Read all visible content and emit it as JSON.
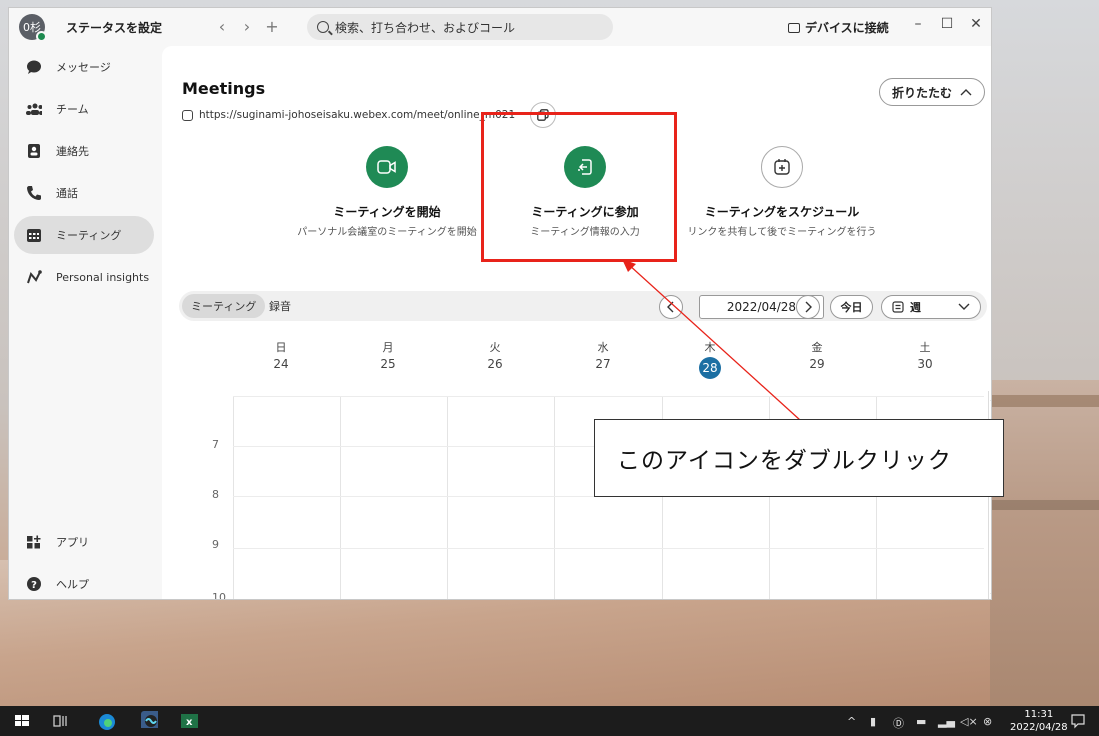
{
  "titlebar": {
    "avatar_initials": "0杉",
    "status_label": "ステータスを設定",
    "back": "‹",
    "forward": "›",
    "add": "+",
    "search_placeholder": "検索、打ち合わせ、およびコール",
    "device_connect": "デバイスに接続",
    "minimize": "–",
    "maximize": "☐",
    "close": "✕"
  },
  "sidebar": {
    "items": [
      {
        "label": "メッセージ",
        "icon": "chat-bubble-icon"
      },
      {
        "label": "チーム",
        "icon": "team-icon"
      },
      {
        "label": "連絡先",
        "icon": "contacts-icon"
      },
      {
        "label": "通話",
        "icon": "phone-icon"
      },
      {
        "label": "ミーティング",
        "icon": "calendar-icon",
        "active": true
      },
      {
        "label": "Personal insights",
        "icon": "insights-icon"
      }
    ],
    "bottom_items": [
      {
        "label": "アプリ",
        "icon": "apps-icon"
      },
      {
        "label": "ヘルプ",
        "icon": "help-icon"
      }
    ]
  },
  "main": {
    "title": "Meetings",
    "url": "https://suginami-johoseisaku.webex.com/meet/online_m021",
    "collapse_label": "折りたたむ",
    "actions": [
      {
        "label": "ミーティングを開始",
        "sub": "パーソナル会議室のミーティングを開始",
        "icon": "video-icon"
      },
      {
        "label": "ミーティングに参加",
        "sub": "ミーティング情報の入力",
        "icon": "join-icon"
      },
      {
        "label": "ミーティングをスケジュール",
        "sub": "リンクを共有して後でミーティングを行う",
        "icon": "schedule-icon"
      }
    ],
    "tabs": [
      {
        "label": "ミーティング",
        "selected": true
      },
      {
        "label": "録音",
        "selected": false
      }
    ],
    "date": "2022/04/28",
    "today_label": "今日",
    "view_label": "週",
    "days": [
      {
        "dow": "日",
        "num": "24"
      },
      {
        "dow": "月",
        "num": "25"
      },
      {
        "dow": "火",
        "num": "26"
      },
      {
        "dow": "水",
        "num": "27"
      },
      {
        "dow": "木",
        "num": "28",
        "today": true
      },
      {
        "dow": "金",
        "num": "29"
      },
      {
        "dow": "土",
        "num": "30"
      }
    ],
    "hours": [
      "7",
      "8",
      "9",
      "10"
    ]
  },
  "annotation": {
    "callout_text": "このアイコンをダブルクリック",
    "highlight_color": "#e8231a"
  },
  "taskbar": {
    "time": "11:31",
    "date": "2022/04/28"
  },
  "colors": {
    "accent_green": "#1f8a55",
    "today_blue": "#1c6fa3"
  }
}
